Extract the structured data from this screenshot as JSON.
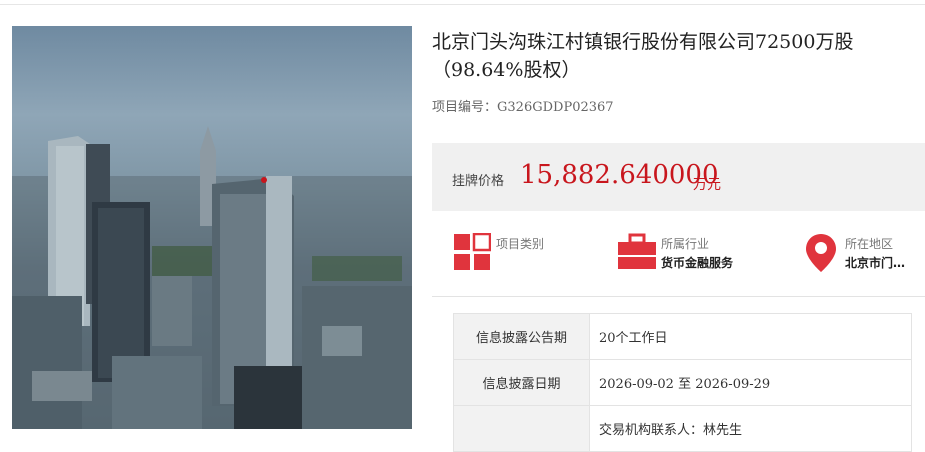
{
  "project": {
    "title": "北京门头沟珠江村镇银行股份有限公司72500万股（98.64%股权）",
    "number_label": "项目编号：",
    "number_value": "G326GDDP02367"
  },
  "price": {
    "label": "挂牌价格",
    "value": "15,882.640000",
    "unit": "万元"
  },
  "info_items": [
    {
      "label": "项目类别",
      "value": "",
      "icon": "category-grid-icon"
    },
    {
      "label": "所属行业",
      "value": "货币金融服务",
      "icon": "briefcase-icon"
    },
    {
      "label": "所在地区",
      "value": "北京市门…",
      "icon": "location-pin-icon"
    }
  ],
  "table": [
    {
      "key": "信息披露公告期",
      "value": "20个工作日"
    },
    {
      "key": "信息披露日期",
      "value": "2026-09-02 至 2026-09-29"
    },
    {
      "key": "",
      "value": "交易机构联系人：林先生"
    }
  ],
  "colors": {
    "accent_red": "#c8161d",
    "icon_red": "#e0343d",
    "panel_gray": "#f0f0f0"
  }
}
